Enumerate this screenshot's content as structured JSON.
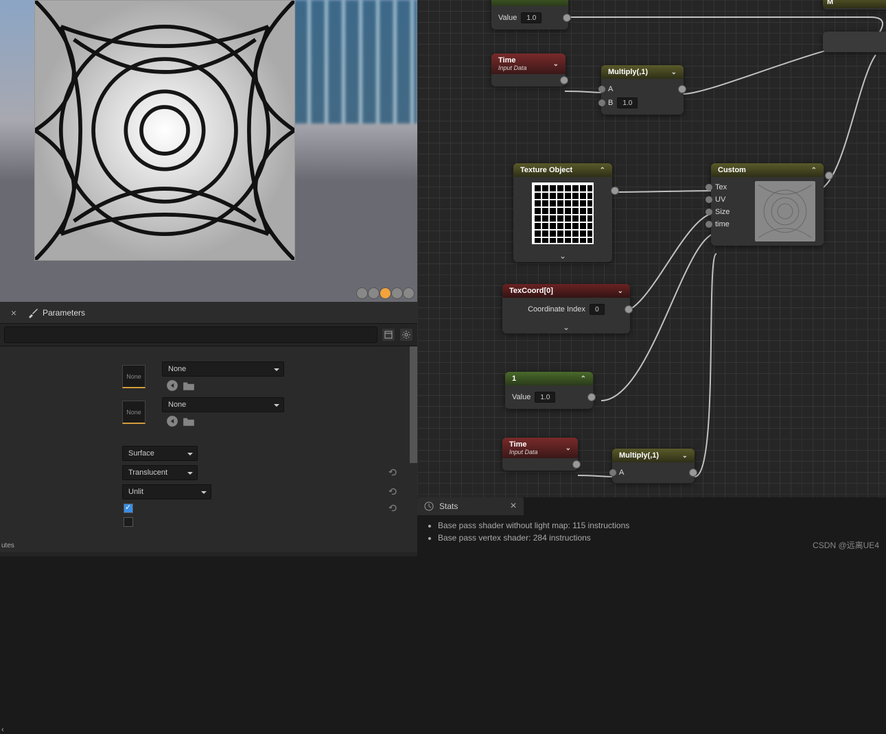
{
  "viewport": {
    "sphere_buttons": [
      "off",
      "off",
      "on",
      "off",
      "off"
    ]
  },
  "parameters": {
    "tab_label": "Parameters",
    "slot1": {
      "thumb": "None",
      "dropdown": "None"
    },
    "slot2": {
      "thumb": "None",
      "dropdown": "None"
    },
    "material_domain": "Surface",
    "blend_mode": "Translucent",
    "shading_model": "Unlit",
    "two_sided": true,
    "fully_rough": false,
    "cut_label": "utes",
    "cut_label2": "‹"
  },
  "graph": {
    "value_node_top": {
      "value_label": "Value",
      "value": "1.0"
    },
    "time1": {
      "title": "Time",
      "subtitle": "Input Data"
    },
    "multiply1": {
      "title": "Multiply(,1)",
      "a": "A",
      "b": "B",
      "bval": "1.0"
    },
    "texobj": {
      "title": "Texture Object"
    },
    "texcoord": {
      "title": "TexCoord[0]",
      "label": "Coordinate Index",
      "value": "0"
    },
    "const1": {
      "title": "1",
      "value_label": "Value",
      "value": "1.0"
    },
    "time2": {
      "title": "Time",
      "subtitle": "Input Data"
    },
    "multiply2": {
      "title": "Multiply(,1)",
      "a": "A"
    },
    "custom": {
      "title": "Custom",
      "pins": [
        "Tex",
        "UV",
        "Size",
        "time"
      ]
    },
    "edge_node": "M"
  },
  "stats": {
    "tab_label": "Stats",
    "lines": [
      "Base pass shader without light map: 115 instructions",
      "Base pass vertex shader: 284 instructions"
    ]
  },
  "watermark": "CSDN @远离UE4"
}
